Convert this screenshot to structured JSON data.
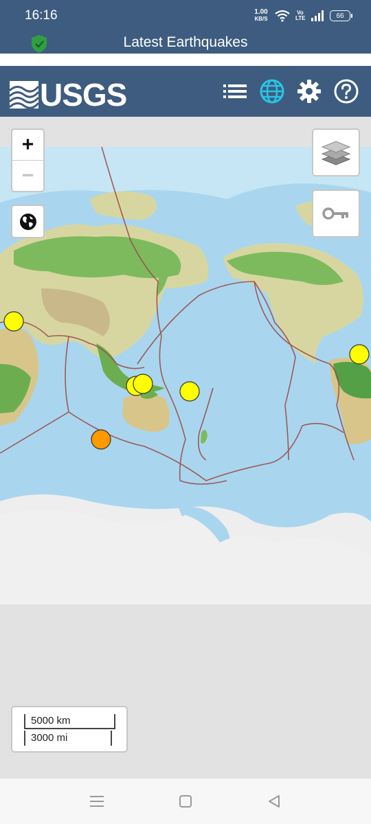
{
  "status_bar": {
    "time": "16:16",
    "net_speed_value": "1.00",
    "net_speed_unit": "KB/S",
    "volte_label": "Vo LTE",
    "battery": "66",
    "icons": [
      "wifi-icon",
      "volte-icon",
      "signal-icon",
      "battery-icon"
    ]
  },
  "app_bar": {
    "title": "Latest Earthquakes",
    "icon": "shield-check-icon"
  },
  "header": {
    "logo_text": "USGS",
    "buttons": [
      "list-icon",
      "globe-icon",
      "gear-icon",
      "help-icon"
    ],
    "active_color": "#29c5e6"
  },
  "map": {
    "controls": {
      "zoom_in": "+",
      "zoom_out": "−",
      "icons": [
        "world-icon",
        "layers-icon",
        "key-icon"
      ]
    },
    "scale": {
      "km": "5000 km",
      "mi": "3000 mi"
    },
    "earthquake_colors": {
      "recent_day": "#ffff00",
      "past_hour": "#ff9900"
    }
  },
  "nav_bar": {
    "icons": [
      "recents-icon",
      "home-icon",
      "back-icon"
    ]
  }
}
